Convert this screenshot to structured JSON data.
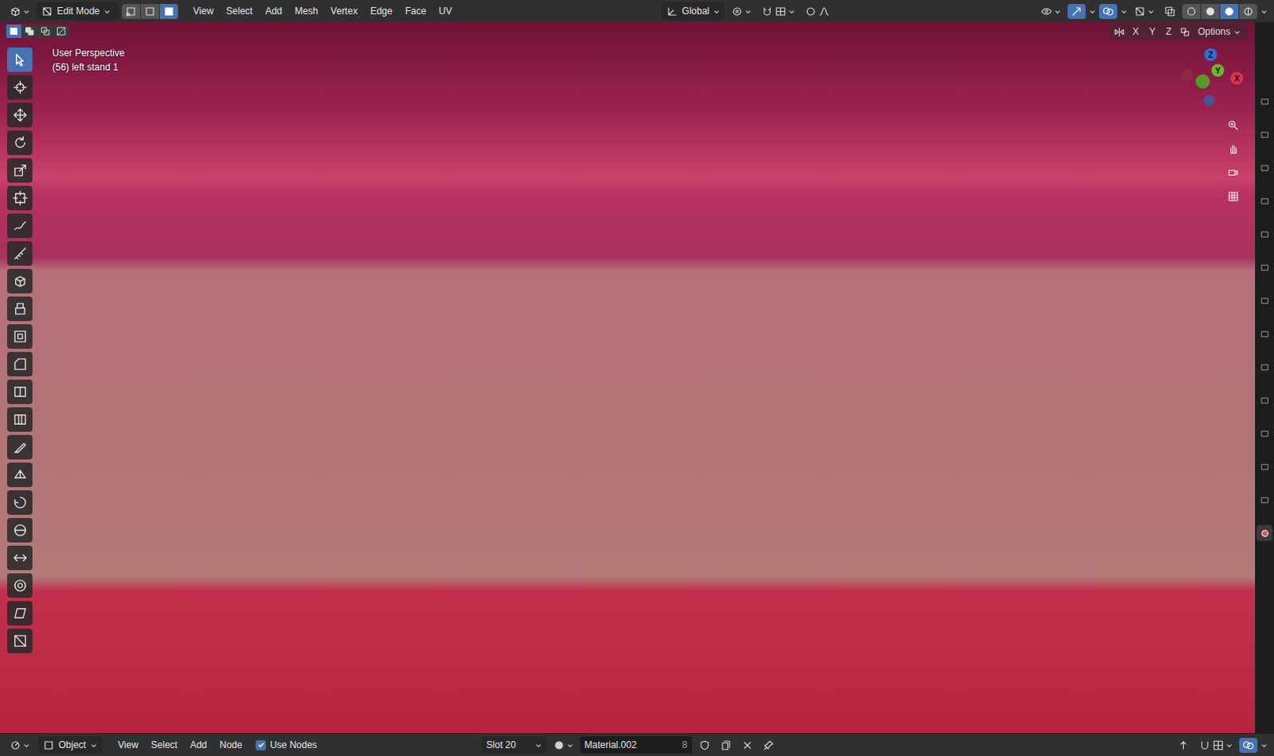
{
  "header": {
    "mode": "Edit Mode",
    "select_modes": [
      {
        "kind": "vertex",
        "selected": false
      },
      {
        "kind": "edge",
        "selected": false
      },
      {
        "kind": "face",
        "selected": true
      }
    ],
    "menus": [
      "View",
      "Select",
      "Add",
      "Mesh",
      "Vertex",
      "Edge",
      "Face",
      "UV"
    ],
    "orientation": "Global",
    "shading": [
      {
        "kind": "wireframe",
        "selected": false
      },
      {
        "kind": "solid",
        "selected": false
      },
      {
        "kind": "material",
        "selected": true
      },
      {
        "kind": "rendered",
        "selected": false
      }
    ]
  },
  "viewport": {
    "view": "User Perspective",
    "object": "(56) left stand 1",
    "select_ops": [
      {
        "kind": "set",
        "selected": true
      },
      {
        "kind": "extend",
        "selected": false
      },
      {
        "kind": "subtract",
        "selected": false
      },
      {
        "kind": "invert",
        "selected": false
      }
    ],
    "tools": [
      {
        "kind": "select",
        "selected": true
      },
      {
        "kind": "cursor",
        "selected": false
      },
      {
        "kind": "move",
        "selected": false
      },
      {
        "kind": "rotate",
        "selected": false
      },
      {
        "kind": "scale",
        "selected": false
      },
      {
        "kind": "transform",
        "selected": false
      },
      {
        "kind": "annotate",
        "selected": false
      },
      {
        "kind": "measure",
        "selected": false
      },
      {
        "kind": "add-cube",
        "selected": false
      },
      {
        "kind": "extrude",
        "selected": false
      },
      {
        "kind": "inset",
        "selected": false
      },
      {
        "kind": "bevel",
        "selected": false
      },
      {
        "kind": "loopcut",
        "selected": false
      },
      {
        "kind": "offset",
        "selected": false
      },
      {
        "kind": "knife",
        "selected": false
      },
      {
        "kind": "polybuild",
        "selected": false
      },
      {
        "kind": "spin",
        "selected": false
      },
      {
        "kind": "smooth",
        "selected": false
      },
      {
        "kind": "edge-slide",
        "selected": false
      },
      {
        "kind": "shrink",
        "selected": false
      },
      {
        "kind": "shear",
        "selected": false
      },
      {
        "kind": "rip",
        "selected": false
      }
    ],
    "options": "Options",
    "mirror_axes": [
      {
        "label": "X",
        "selected": false
      },
      {
        "label": "Y",
        "selected": false
      },
      {
        "label": "Z",
        "selected": false
      }
    ],
    "gizmo": [
      {
        "label": "Z",
        "color": "#2f6fd6"
      },
      {
        "label": "Y",
        "color": "#6fb52c"
      },
      {
        "label": "X",
        "color": "#e0304a"
      }
    ],
    "nav": [
      {
        "kind": "zoom"
      },
      {
        "kind": "pan"
      },
      {
        "kind": "camera"
      },
      {
        "kind": "ortho"
      }
    ]
  },
  "properties_tabs": [
    {
      "kind": "tool",
      "selected": false
    },
    {
      "kind": "render",
      "selected": false
    },
    {
      "kind": "output",
      "selected": false
    },
    {
      "kind": "view-layer",
      "selected": false
    },
    {
      "kind": "scene",
      "selected": false
    },
    {
      "kind": "world",
      "selected": false
    },
    {
      "kind": "collection",
      "selected": false
    },
    {
      "kind": "object",
      "selected": false
    },
    {
      "kind": "modifiers",
      "selected": false
    },
    {
      "kind": "particles",
      "selected": false
    },
    {
      "kind": "physics",
      "selected": false
    },
    {
      "kind": "constraints",
      "selected": false
    },
    {
      "kind": "data",
      "selected": false
    },
    {
      "kind": "material",
      "selected": true
    }
  ],
  "footer": {
    "editor": "Object",
    "menus": [
      "View",
      "Select",
      "Add",
      "Node"
    ],
    "use_nodes": {
      "label": "Use Nodes",
      "checked": true
    },
    "slot": "Slot 20",
    "material": "Material.002",
    "users": "8"
  }
}
